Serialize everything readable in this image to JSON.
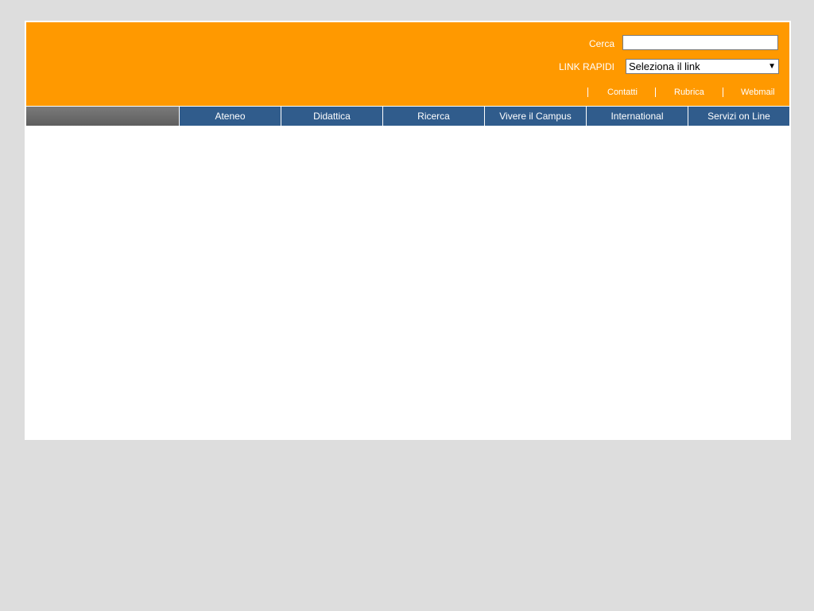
{
  "header": {
    "search": {
      "label": "Cerca",
      "value": "",
      "placeholder": ""
    },
    "quick_links": {
      "label": "LINK RAPIDI",
      "selected": "Seleziona il link"
    },
    "utility_links": [
      {
        "label": "Contatti"
      },
      {
        "label": "Rubrica"
      },
      {
        "label": "Webmail"
      }
    ]
  },
  "nav": {
    "items": [
      {
        "label": "Ateneo"
      },
      {
        "label": "Didattica"
      },
      {
        "label": "Ricerca"
      },
      {
        "label": "Vivere il Campus"
      },
      {
        "label": "International"
      },
      {
        "label": "Servizi on Line"
      }
    ]
  },
  "colors": {
    "background": "#dddddd",
    "header": "#ff9900",
    "nav_item": "#305c8c",
    "nav_spacer": "#6b6b6b"
  }
}
